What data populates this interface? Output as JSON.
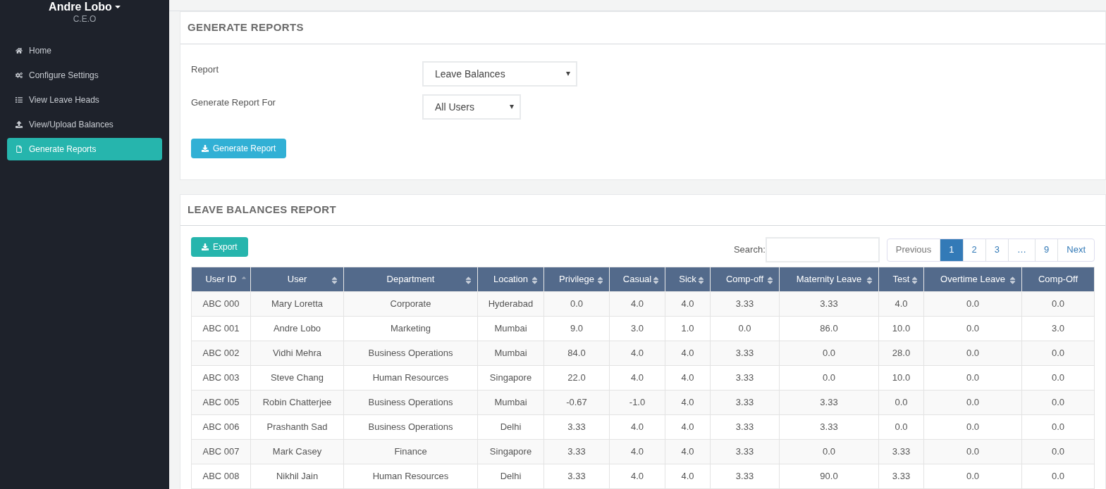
{
  "profile": {
    "name": "Andre Lobo",
    "role": "C.E.O"
  },
  "sidebar": {
    "items": [
      {
        "label": "Home",
        "selected": false
      },
      {
        "label": "Configure Settings",
        "selected": false
      },
      {
        "label": "View Leave Heads",
        "selected": false
      },
      {
        "label": "View/Upload Balances",
        "selected": false
      },
      {
        "label": "Generate Reports",
        "selected": true
      }
    ]
  },
  "generate_panel": {
    "title": "GENERATE REPORTS",
    "fields": [
      {
        "label": "Report",
        "value": "Leave Balances"
      },
      {
        "label": "Generate Report For",
        "value": "All Users"
      }
    ],
    "button": "Generate Report"
  },
  "report_panel": {
    "title": "LEAVE BALANCES REPORT",
    "export": "Export",
    "search_label": "Search:",
    "pagination": [
      {
        "label": "Previous",
        "selected": false
      },
      {
        "label": "1",
        "selected": true
      },
      {
        "label": "2",
        "selected": false
      },
      {
        "label": "3",
        "selected": false
      },
      {
        "label": "…",
        "selected": false
      },
      {
        "label": "9",
        "selected": false
      },
      {
        "label": "Next",
        "selected": false
      }
    ],
    "table": {
      "columns": [
        {
          "label": "User ID",
          "kind": "sorted"
        },
        {
          "label": "User",
          "kind": "sortable"
        },
        {
          "label": "Department",
          "kind": "sortable"
        },
        {
          "label": "Location",
          "kind": "sortable"
        },
        {
          "label": "Privilege",
          "kind": "sortable"
        },
        {
          "label": "Casual",
          "kind": "sortable"
        },
        {
          "label": "Sick",
          "kind": "sortable"
        },
        {
          "label": "Comp-off",
          "kind": "sortable"
        },
        {
          "label": "Maternity Leave",
          "kind": "sortable"
        },
        {
          "label": "Test",
          "kind": "sortable"
        },
        {
          "label": "Overtime Leave",
          "kind": "sortable"
        },
        {
          "label": "Comp-Off",
          "kind": "plain"
        }
      ],
      "rows": [
        [
          "ABC 000",
          "Mary Loretta",
          "Corporate",
          "Hyderabad",
          "0.0",
          "4.0",
          "4.0",
          "3.33",
          "3.33",
          "4.0",
          "0.0",
          "0.0"
        ],
        [
          "ABC 001",
          "Andre Lobo",
          "Marketing",
          "Mumbai",
          "9.0",
          "3.0",
          "1.0",
          "0.0",
          "86.0",
          "10.0",
          "0.0",
          "3.0"
        ],
        [
          "ABC 002",
          "Vidhi Mehra",
          "Business Operations",
          "Mumbai",
          "84.0",
          "4.0",
          "4.0",
          "3.33",
          "0.0",
          "28.0",
          "0.0",
          "0.0"
        ],
        [
          "ABC 003",
          "Steve Chang",
          "Human Resources",
          "Singapore",
          "22.0",
          "4.0",
          "4.0",
          "3.33",
          "0.0",
          "10.0",
          "0.0",
          "0.0"
        ],
        [
          "ABC 005",
          "Robin Chatterjee",
          "Business Operations",
          "Mumbai",
          "-0.67",
          "-1.0",
          "4.0",
          "3.33",
          "3.33",
          "0.0",
          "0.0",
          "0.0"
        ],
        [
          "ABC 006",
          "Prashanth Sad",
          "Business Operations",
          "Delhi",
          "3.33",
          "4.0",
          "4.0",
          "3.33",
          "3.33",
          "0.0",
          "0.0",
          "0.0"
        ],
        [
          "ABC 007",
          "Mark Casey",
          "Finance",
          "Singapore",
          "3.33",
          "4.0",
          "4.0",
          "3.33",
          "0.0",
          "3.33",
          "0.0",
          "0.0"
        ],
        [
          "ABC 008",
          "Nikhil Jain",
          "Human Resources",
          "Delhi",
          "3.33",
          "4.0",
          "4.0",
          "3.33",
          "90.0",
          "3.33",
          "0.0",
          "0.0"
        ]
      ]
    }
  }
}
